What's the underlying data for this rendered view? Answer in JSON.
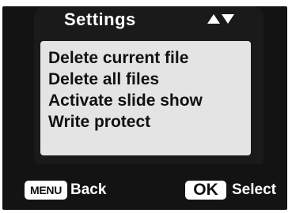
{
  "header": {
    "title": "Settings",
    "nav_icon": "up-down-arrows"
  },
  "menu": {
    "items": [
      {
        "label": "Delete current file"
      },
      {
        "label": "Delete all files"
      },
      {
        "label": "Activate slide show"
      },
      {
        "label": "Write protect"
      }
    ]
  },
  "footer": {
    "menu_key": "MENU",
    "menu_action": "Back",
    "ok_key": "OK",
    "ok_action": "Select"
  },
  "colors": {
    "frame": "#131313",
    "list_background": "#e4e4e4",
    "text_dark": "#111111",
    "text_light": "#ffffff"
  }
}
